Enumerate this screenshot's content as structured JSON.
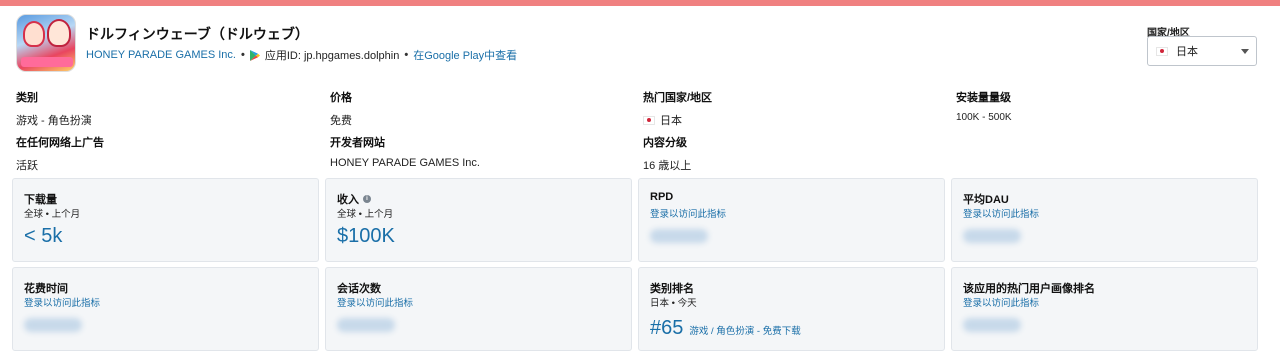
{
  "app": {
    "title": "ドルフィンウェーブ（ドルウェブ）",
    "developer": "HONEY PARADE GAMES Inc.",
    "app_id": "应用ID: jp.hpgames.dolphin",
    "store_link": "在Google Play中查看"
  },
  "country_select": {
    "label": "国家/地区",
    "value": "日本"
  },
  "info": {
    "category": {
      "label": "类别",
      "value": "游戏 - 角色扮演"
    },
    "price": {
      "label": "价格",
      "value": "免费"
    },
    "top_country": {
      "label": "热门国家/地区",
      "value": "日本"
    },
    "installs": {
      "label": "安装量量级",
      "value": "100K - 500K"
    },
    "ads": {
      "label": "在任何网络上广告",
      "value": "活跃"
    },
    "dev_site": {
      "label": "开发者网站",
      "value": "HONEY PARADE GAMES Inc."
    },
    "content_rating": {
      "label": "内容分级",
      "value": "16 歳以上"
    }
  },
  "cards": {
    "downloads": {
      "title": "下载量",
      "sub": "全球 • 上个月",
      "value": "< 5k"
    },
    "revenue": {
      "title": "收入",
      "sub": "全球 • 上个月",
      "value": "$100K"
    },
    "rpd": {
      "title": "RPD",
      "sub": "登录以访问此指标"
    },
    "dau": {
      "title": "平均DAU",
      "sub": "登录以访问此指标"
    },
    "time_spent": {
      "title": "花费时间",
      "sub": "登录以访问此指标"
    },
    "sessions": {
      "title": "会话次数",
      "sub": "登录以访问此指标"
    },
    "category_rank": {
      "title": "类别排名",
      "sub": "日本 • 今天",
      "rank": "#65",
      "rank_detail": "游戏 / 角色扮演 - 免费下载"
    },
    "audience_rank": {
      "title": "该应用的热门用户画像排名",
      "sub": "登录以访问此指标"
    }
  },
  "colors": {
    "accent": "#1a6fa8",
    "top_bar": "#f08080",
    "card_bg": "#f4f6f8"
  },
  "icons": [
    "app-icon",
    "google-play-icon",
    "japan-flag-icon",
    "chevron-down-icon",
    "info-icon"
  ]
}
